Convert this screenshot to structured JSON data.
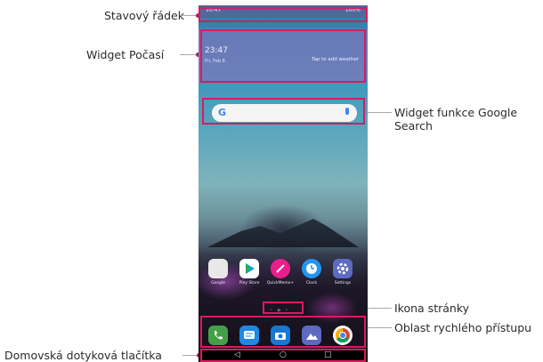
{
  "labels": {
    "status_bar": "Stavový řádek",
    "weather_widget": "Widget Počasí",
    "google_widget_line1": "Widget funkce Google",
    "google_widget_line2": "Search",
    "page_icon": "Ikona stránky",
    "quick_access": "Oblast rychlého přístupu",
    "home_touch_buttons": "Domovská dotyková tlačítka"
  },
  "phone": {
    "status_time": "10:47",
    "status_battery": "100%",
    "weather_time": "23:47",
    "weather_date": "Fri, Feb 8",
    "weather_cta": "Tap to add weather",
    "search_logo": "G",
    "apps": [
      {
        "label": "Google",
        "icon": "google-folder-icon",
        "color": "#e8e8e8"
      },
      {
        "label": "Play Store",
        "icon": "play-store-icon",
        "color": "#ffffff"
      },
      {
        "label": "QuickMemo+",
        "icon": "quickmemo-icon",
        "color": "#e91e8c"
      },
      {
        "label": "Clock",
        "icon": "clock-icon",
        "color": "#2196f3"
      },
      {
        "label": "Settings",
        "icon": "settings-icon",
        "color": "#5c6bc0"
      }
    ],
    "pager": "◦ ⌂ ◦",
    "dock": [
      {
        "icon": "phone-icon",
        "color": "#43a047"
      },
      {
        "icon": "messages-icon",
        "color": "#1e88e5"
      },
      {
        "icon": "camera-icon",
        "color": "#1976d2"
      },
      {
        "icon": "gallery-icon",
        "color": "#5c6bc0"
      },
      {
        "icon": "chrome-icon",
        "color": "#ffffff"
      }
    ],
    "nav": {
      "back": "◁",
      "home": "○",
      "recents": "□"
    }
  },
  "colors": {
    "highlight": "#d81b60",
    "leader_line": "#a8a8a8"
  }
}
